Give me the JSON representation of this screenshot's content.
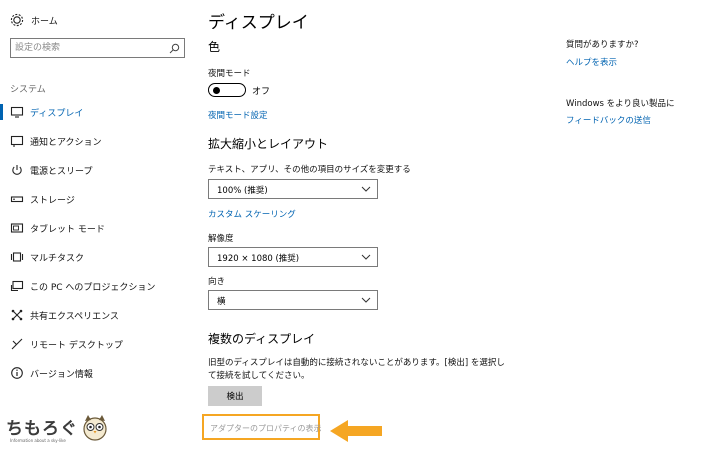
{
  "sidebar": {
    "home_label": "ホーム",
    "search_placeholder": "設定の検索",
    "section_heading": "システム",
    "items": [
      {
        "label": "ディスプレイ",
        "icon": "monitor-icon",
        "active": true
      },
      {
        "label": "通知とアクション",
        "icon": "notification-icon"
      },
      {
        "label": "電源とスリープ",
        "icon": "power-icon"
      },
      {
        "label": "ストレージ",
        "icon": "storage-icon"
      },
      {
        "label": "タブレット モード",
        "icon": "tablet-icon"
      },
      {
        "label": "マルチタスク",
        "icon": "multitask-icon"
      },
      {
        "label": "この PC へのプロジェクション",
        "icon": "projection-icon"
      },
      {
        "label": "共有エクスペリエンス",
        "icon": "shared-experience-icon"
      },
      {
        "label": "リモート デスクトップ",
        "icon": "remote-desktop-icon"
      },
      {
        "label": "バージョン情報",
        "icon": "info-icon"
      }
    ]
  },
  "main": {
    "page_title": "ディスプレイ",
    "color": {
      "heading": "色",
      "night_mode_label": "夜間モード",
      "night_mode_state": "オフ",
      "night_mode_settings_link": "夜間モード設定"
    },
    "scale": {
      "heading": "拡大縮小とレイアウト",
      "size_label": "テキスト、アプリ、その他の項目のサイズを変更する",
      "size_value": "100% (推奨)",
      "custom_scaling_link": "カスタム スケーリング",
      "resolution_label": "解像度",
      "resolution_value": "1920 × 1080 (推奨)",
      "orientation_label": "向き",
      "orientation_value": "横"
    },
    "multi": {
      "heading": "複数のディスプレイ",
      "description_line1": "旧型のディスプレイは自動的に接続されないことがあります。[検出] を選択し",
      "description_line2": "て接続を試してください。",
      "detect_button": "検出",
      "adapter_link": "アダプターのプロパティの表示"
    }
  },
  "right": {
    "question": "質問がありますか?",
    "help_link": "ヘルプを表示",
    "improve": "Windows をより良い製品に",
    "feedback_link": "フィードバックの送信"
  },
  "logo": {
    "name": "ちもろぐ",
    "tagline": "Information about a sky-like"
  },
  "colors": {
    "accent": "#0063b1",
    "highlight": "#f5a623"
  }
}
